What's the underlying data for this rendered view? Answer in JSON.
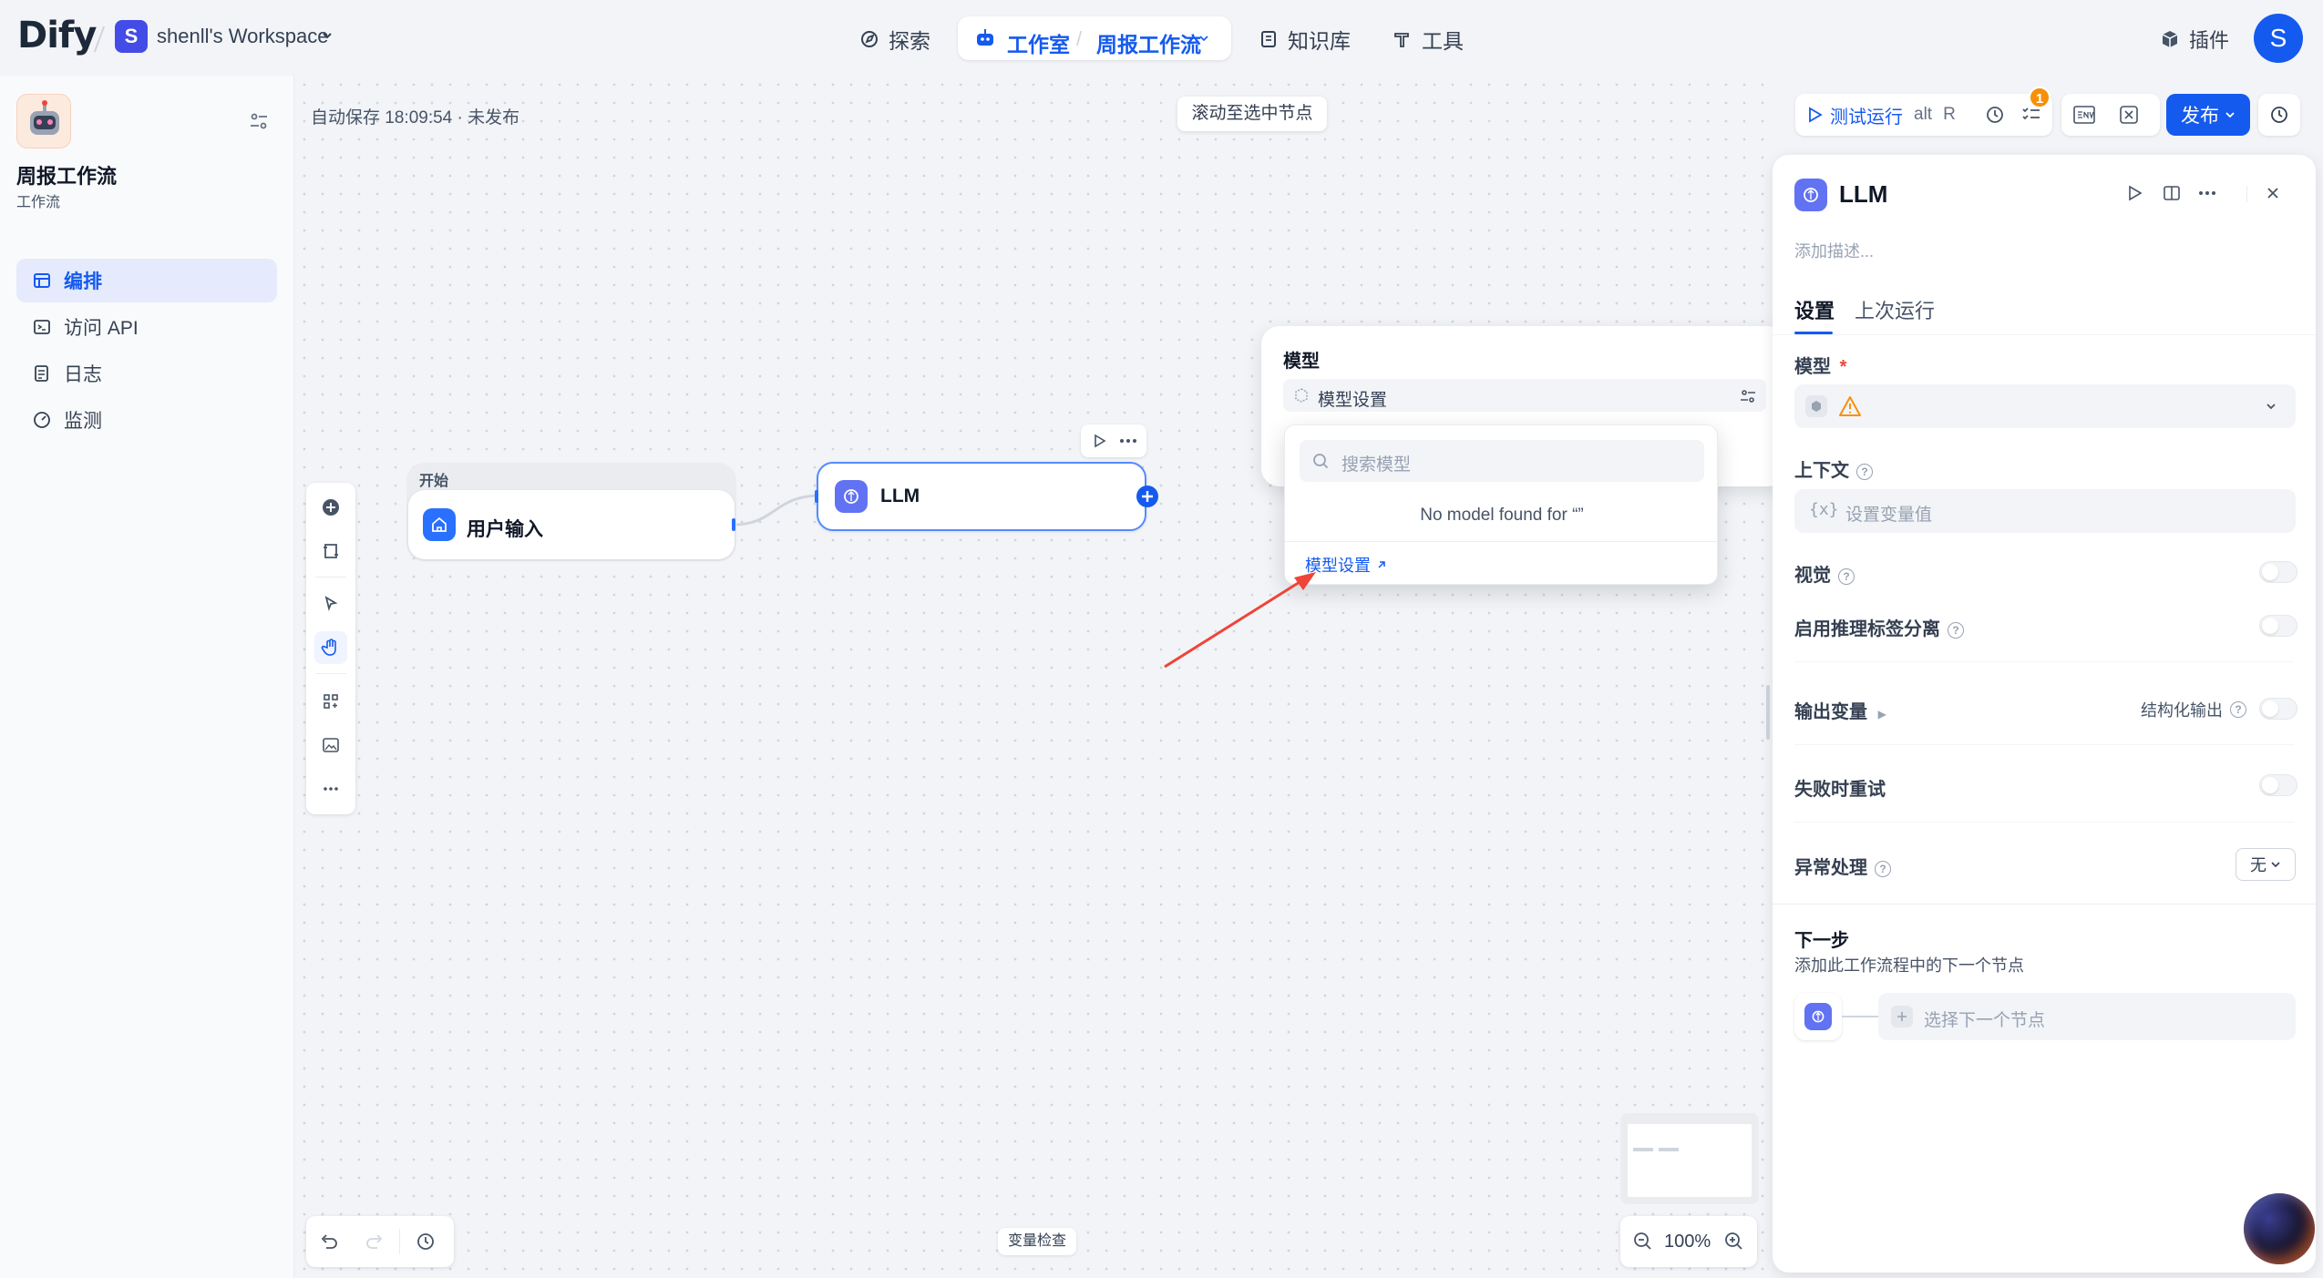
{
  "header": {
    "logo": "Dify",
    "workspace_badge": "S",
    "workspace_name": "shenll's Workspace",
    "nav": {
      "explore": "探索",
      "studio": "工作室",
      "current_app": "周报工作流",
      "knowledge": "知识库",
      "tools": "工具"
    },
    "plugins": "插件",
    "avatar": "S"
  },
  "sidebar": {
    "app_title": "周报工作流",
    "app_type": "工作流",
    "items": [
      {
        "label": "编排",
        "icon": "layout-icon",
        "active": true
      },
      {
        "label": "访问 API",
        "icon": "terminal-icon",
        "active": false
      },
      {
        "label": "日志",
        "icon": "log-icon",
        "active": false
      },
      {
        "label": "监测",
        "icon": "gauge-icon",
        "active": false
      }
    ]
  },
  "canvas": {
    "autosave": "自动保存 18:09:54 · 未发布",
    "scroll_to_node": "滚动至选中节点",
    "start_node": {
      "tag": "开始",
      "title": "用户输入"
    },
    "llm_node": {
      "title": "LLM"
    },
    "variable_check": "变量检查",
    "zoom": "100%"
  },
  "model_popover": {
    "title": "模型",
    "placeholder": "模型设置",
    "search_placeholder": "搜索模型",
    "empty": "No model found for “”",
    "settings_link": "模型设置"
  },
  "actions": {
    "test_run": "测试运行",
    "shortcut_alt": "alt",
    "shortcut_key": "R",
    "checklist_badge": "1",
    "publish": "发布"
  },
  "panel": {
    "title": "LLM",
    "desc_placeholder": "添加描述...",
    "tabs": [
      "设置",
      "上次运行"
    ],
    "model_label": "模型",
    "required_mark": "*",
    "context_label": "上下文",
    "context_placeholder": "设置变量值",
    "vision_label": "视觉",
    "reasoning_label": "启用推理标签分离",
    "output_vars_label": "输出变量",
    "structured_output_label": "结构化输出",
    "retry_label": "失败时重试",
    "error_label": "异常处理",
    "error_value": "无",
    "next_step_label": "下一步",
    "next_step_desc": "添加此工作流程中的下一个节点",
    "next_step_placeholder": "选择下一个节点"
  },
  "colors": {
    "primary": "#155aef",
    "warning": "#f79009",
    "annotation_arrow": "#f04438",
    "badge": "#f79009"
  }
}
